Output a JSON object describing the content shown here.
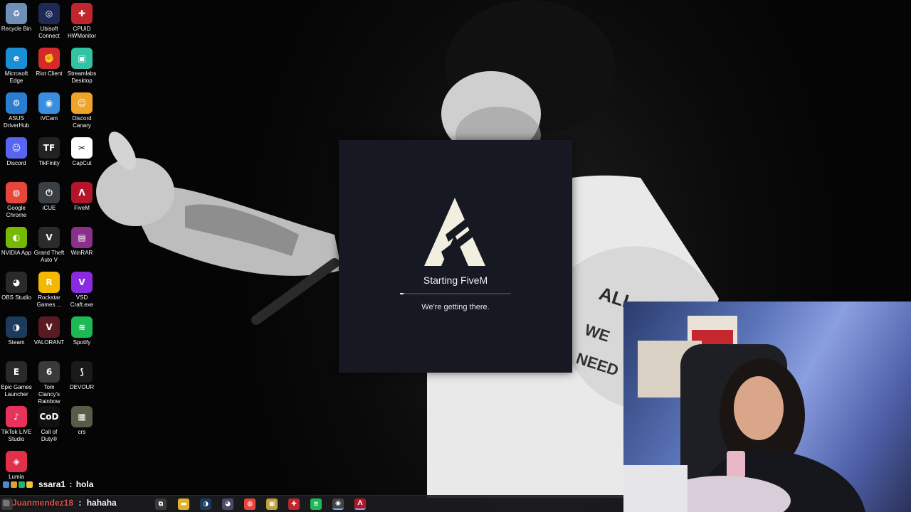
{
  "desktop": {
    "icons": [
      {
        "label": "Recycle Bin",
        "icon": "recycle-bin-icon",
        "color": "#6f8fb8",
        "glyph": "♻"
      },
      {
        "label": "Ubisoft Connect",
        "icon": "ubisoft-icon",
        "color": "#1e2a55",
        "glyph": "◎"
      },
      {
        "label": "CPUID HWMonitor",
        "icon": "hwmonitor-icon",
        "color": "#c0262d",
        "glyph": "✚"
      },
      {
        "label": "Microsoft Edge",
        "icon": "edge-icon",
        "color": "#1a8fd6",
        "glyph": "e"
      },
      {
        "label": "Riot Client",
        "icon": "riot-icon",
        "color": "#d42a2a",
        "glyph": "✊"
      },
      {
        "label": "Streamlabs Desktop",
        "icon": "streamlabs-icon",
        "color": "#31c3a2",
        "glyph": "▣"
      },
      {
        "label": "ASUS DriverHub",
        "icon": "asus-driverhub-icon",
        "color": "#2a7ed1",
        "glyph": "⚙"
      },
      {
        "label": "iVCam",
        "icon": "ivcam-icon",
        "color": "#3a8ee0",
        "glyph": "◉"
      },
      {
        "label": "Discord Canary",
        "icon": "discord-canary-icon",
        "color": "#f0a42a",
        "glyph": "☺"
      },
      {
        "label": "Discord",
        "icon": "discord-icon",
        "color": "#5865f2",
        "glyph": "☺"
      },
      {
        "label": "TikFinity",
        "icon": "tikfinity-icon",
        "color": "#222222",
        "glyph": "TF"
      },
      {
        "label": "CapCut",
        "icon": "capcut-icon",
        "color": "#ffffff",
        "glyph": "✂"
      },
      {
        "label": "Google Chrome",
        "icon": "chrome-icon",
        "color": "#e8453c",
        "glyph": "◍"
      },
      {
        "label": "iCUE",
        "icon": "icue-icon",
        "color": "#3a3f44",
        "glyph": "⏻"
      },
      {
        "label": "FiveM",
        "icon": "fivem-icon",
        "color": "#b3152b",
        "glyph": "Λ"
      },
      {
        "label": "NVIDIA App",
        "icon": "nvidia-icon",
        "color": "#76b900",
        "glyph": "◐"
      },
      {
        "label": "Grand Theft Auto V",
        "icon": "gta5-icon",
        "color": "#2b2b2b",
        "glyph": "V"
      },
      {
        "label": "WinRAR",
        "icon": "winrar-icon",
        "color": "#8a2f8a",
        "glyph": "▤"
      },
      {
        "label": "OBS Studio",
        "icon": "obs-icon",
        "color": "#2a2a2a",
        "glyph": "◕"
      },
      {
        "label": "Rockstar Games ...",
        "icon": "rockstar-icon",
        "color": "#f5b800",
        "glyph": "R"
      },
      {
        "label": "VSD Craft.exe",
        "icon": "vsd-craft-icon",
        "color": "#8a2be2",
        "glyph": "V"
      },
      {
        "label": "Steam",
        "icon": "steam-icon",
        "color": "#1b3a5c",
        "glyph": "◑"
      },
      {
        "label": "VALORANT",
        "icon": "valorant-icon",
        "color": "#5a1a22",
        "glyph": "V"
      },
      {
        "label": "Spotify",
        "icon": "spotify-icon",
        "color": "#1db954",
        "glyph": "≋"
      },
      {
        "label": "Epic Games Launcher",
        "icon": "epic-games-icon",
        "color": "#2a2a2a",
        "glyph": "E"
      },
      {
        "label": "Tom Clancy's Rainbow Si...",
        "icon": "rainbow-six-icon",
        "color": "#3a3a3a",
        "glyph": "6"
      },
      {
        "label": "DEVOUR",
        "icon": "devour-icon",
        "color": "#1a1a1a",
        "glyph": "⟆"
      },
      {
        "label": "TikTok LIVE Studio",
        "icon": "tiktok-live-icon",
        "color": "#e8315b",
        "glyph": "♪"
      },
      {
        "label": "Call of Duty®",
        "icon": "call-of-duty-icon",
        "color": "#111111",
        "glyph": "CoD"
      },
      {
        "label": "crs",
        "icon": "crs-icon",
        "color": "#5a5a48",
        "glyph": "▦"
      },
      {
        "label": "Lumia",
        "icon": "lumia-icon",
        "color": "#e0304a",
        "glyph": "◈"
      }
    ]
  },
  "launcher": {
    "title": "Starting FiveM",
    "status": "We're getting there.",
    "progress_percent": 3,
    "logo_icon": "fivem-logo-icon",
    "background": "#161921",
    "logo_color": "#f2efe0"
  },
  "chat": {
    "messages": [
      {
        "user": "ssara1",
        "separator": " : ",
        "text": "hola",
        "user_color": "#ffffff"
      },
      {
        "user": "Juanmendez18",
        "separator": " : ",
        "text": "hahaha",
        "user_color": "#d9534f"
      }
    ]
  },
  "taskbar": {
    "icons": [
      {
        "name": "start-icon",
        "glyph": "⊞",
        "color": "#3a3a3a"
      },
      {
        "name": "task-view-icon",
        "glyph": "⧉",
        "color": "#3a3a3a"
      },
      {
        "name": "file-explorer-icon",
        "glyph": "▬",
        "color": "#e0b030"
      },
      {
        "name": "steam-taskbar-icon",
        "glyph": "◑",
        "color": "#1b3a5c"
      },
      {
        "name": "obs-taskbar-icon",
        "glyph": "◕",
        "color": "#4a4a6a"
      },
      {
        "name": "chrome-taskbar-icon",
        "glyph": "◍",
        "color": "#e8453c"
      },
      {
        "name": "app-taskbar-icon",
        "glyph": "▣",
        "color": "#c0a040"
      },
      {
        "name": "hwmonitor-taskbar-icon",
        "glyph": "✚",
        "color": "#c0262d"
      },
      {
        "name": "spotify-taskbar-icon",
        "glyph": "≋",
        "color": "#1db954"
      },
      {
        "name": "streamlabs-taskbar-icon",
        "glyph": "◉",
        "color": "#444444"
      },
      {
        "name": "fivem-taskbar-icon",
        "glyph": "Λ",
        "color": "#b3152b"
      }
    ]
  }
}
